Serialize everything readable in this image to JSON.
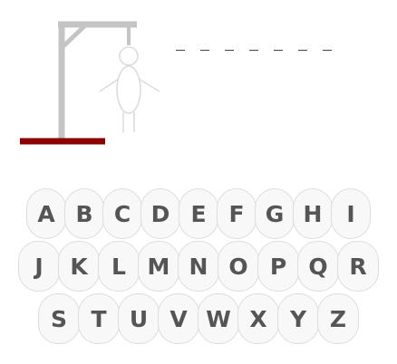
{
  "game": {
    "word_slots": [
      "",
      "",
      "",
      "",
      "",
      "",
      ""
    ],
    "wrong_guesses": 0
  },
  "colors": {
    "gallows": "#c4c4c4",
    "base": "#8b0000",
    "figure_outline": "#dcdcdc",
    "key_background": "#f8f8f8",
    "key_border": "#dddddd",
    "key_text": "#555555"
  },
  "keyboard": {
    "rows": [
      [
        "A",
        "B",
        "C",
        "D",
        "E",
        "F",
        "G",
        "H",
        "I"
      ],
      [
        "J",
        "K",
        "L",
        "M",
        "N",
        "O",
        "P",
        "Q",
        "R"
      ],
      [
        "S",
        "T",
        "U",
        "V",
        "W",
        "X",
        "Y",
        "Z"
      ]
    ]
  }
}
